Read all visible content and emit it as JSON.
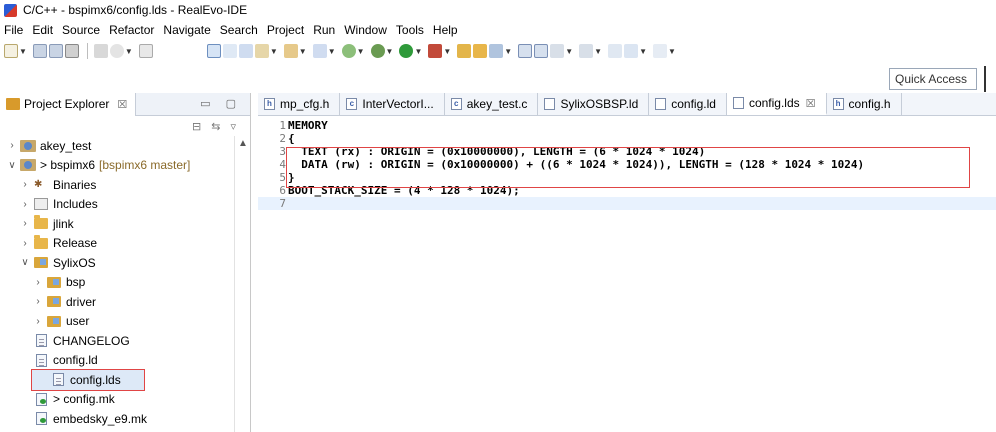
{
  "window": {
    "title": "C/C++ - bspimx6/config.lds - RealEvo-IDE"
  },
  "menu": [
    "File",
    "Edit",
    "Source",
    "Refactor",
    "Navigate",
    "Search",
    "Project",
    "Run",
    "Window",
    "Tools",
    "Help"
  ],
  "quick_access": {
    "placeholder": "Quick Access"
  },
  "project_explorer": {
    "tab_label": "Project Explorer",
    "close_glyph": "☒",
    "tree": [
      {
        "name": "akey_test",
        "indent": 0,
        "twisty": ">",
        "icon": "project-icon"
      },
      {
        "name": "> bspimx6",
        "suffix": "[bspimx6 master]",
        "indent": 0,
        "twisty": "v",
        "icon": "project-icon"
      },
      {
        "name": "Binaries",
        "indent": 1,
        "twisty": ">",
        "icon": "binaries-icon"
      },
      {
        "name": "Includes",
        "indent": 1,
        "twisty": ">",
        "icon": "includes-icon"
      },
      {
        "name": "jlink",
        "indent": 1,
        "twisty": ">",
        "icon": "folder-icon"
      },
      {
        "name": "Release",
        "indent": 1,
        "twisty": ">",
        "icon": "folder-icon"
      },
      {
        "name": "SylixOS",
        "indent": 1,
        "twisty": "v",
        "icon": "package-icon"
      },
      {
        "name": "bsp",
        "indent": 2,
        "twisty": ">",
        "icon": "package-icon"
      },
      {
        "name": "driver",
        "indent": 2,
        "twisty": ">",
        "icon": "package-icon"
      },
      {
        "name": "user",
        "indent": 2,
        "twisty": ">",
        "icon": "package-icon"
      },
      {
        "name": "CHANGELOG",
        "indent": 1,
        "twisty": "",
        "icon": "file-icon"
      },
      {
        "name": "config.ld",
        "indent": 1,
        "twisty": "",
        "icon": "file-icon"
      },
      {
        "name": "config.lds",
        "indent": 1,
        "twisty": "",
        "icon": "file-icon",
        "selected": true
      },
      {
        "name": "> config.mk",
        "indent": 1,
        "twisty": "",
        "icon": "makefile-icon"
      },
      {
        "name": "embedsky_e9.mk",
        "indent": 1,
        "twisty": "",
        "icon": "makefile-icon"
      }
    ]
  },
  "editor": {
    "tabs": [
      {
        "label": "mp_cfg.h",
        "type": "c-header"
      },
      {
        "label": "InterVectorI...",
        "type": "c-source"
      },
      {
        "label": "akey_test.c",
        "type": "c-source"
      },
      {
        "label": "SylixOSBSP.ld",
        "type": "text"
      },
      {
        "label": "config.ld",
        "type": "text"
      },
      {
        "label": "config.lds",
        "type": "text",
        "active": true
      },
      {
        "label": "config.h",
        "type": "c-header"
      }
    ],
    "lines": [
      {
        "n": "1",
        "text": "MEMORY"
      },
      {
        "n": "2",
        "text": "{"
      },
      {
        "n": "3",
        "text": "  TEXT (rx) : ORIGIN = (0x10000000), LENGTH = (6 * 1024 * 1024)"
      },
      {
        "n": "4",
        "text": "  DATA (rw) : ORIGIN = (0x10000000) + ((6 * 1024 * 1024)), LENGTH = (128 * 1024 * 1024)"
      },
      {
        "n": "5",
        "text": "}"
      },
      {
        "n": "6",
        "text": "BOOT_STACK_SIZE = (4 * 128 * 1024);"
      },
      {
        "n": "7",
        "text": "",
        "current": true
      }
    ]
  },
  "colors": {
    "highlight_border": "#e04545",
    "selection_bg": "#dde9f7",
    "current_line": "#e8f2fe"
  }
}
